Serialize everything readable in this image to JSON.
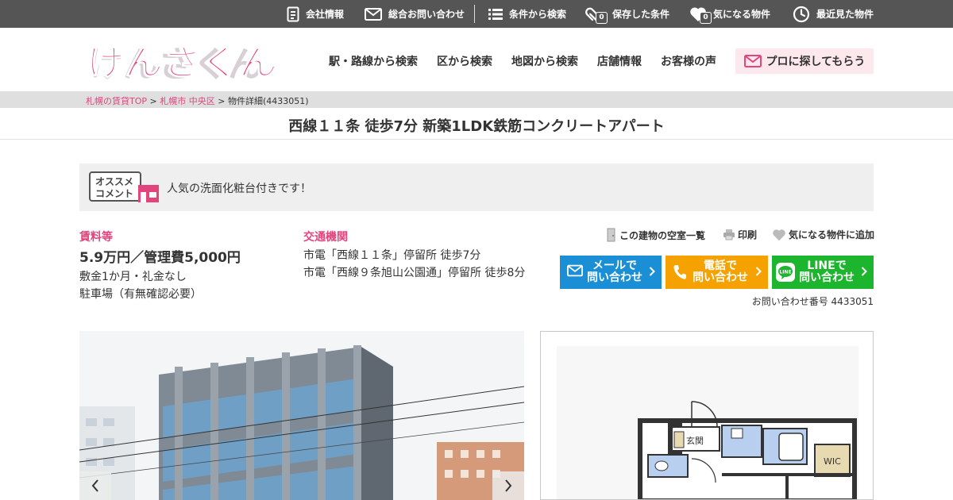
{
  "topbar": {
    "company": "会社情報",
    "contact": "総合お問い合わせ",
    "search_by_condition": "条件から検索",
    "saved_conditions": "保存した条件",
    "saved_count": "0",
    "favorites": "気になる物件",
    "favorites_count": "0",
    "recently_viewed": "最近見た物件"
  },
  "header": {
    "logo_text": "けんさくん",
    "nav": [
      "駅・路線から検索",
      "区から検索",
      "地図から検索",
      "店舗情報",
      "お客様の声"
    ],
    "pro_button": "プロに探してもらう"
  },
  "breadcrumb": {
    "home": "札幌の賃貸TOP",
    "sep": " > ",
    "area": "札幌市 中央区",
    "current": "物件詳細(4433051)"
  },
  "page_title": "西線１１条 徒歩7分 新築1LDK鉄筋コンクリートアパート",
  "recommend": {
    "badge_line1": "オススメ",
    "badge_line2": "コメント",
    "text": "人気の洗面化粧台付きです！"
  },
  "rent": {
    "label": "賃料等",
    "price": "5.9万円／管理費5,000円",
    "deposit": "敷金1か月・礼金なし",
    "parking": "駐車場（有無確認必要）"
  },
  "transport": {
    "label": "交通機関",
    "lines": [
      "市電「西線１１条」停留所 徒歩7分",
      "市電「西線９条旭山公園通」停留所 徒歩8分"
    ]
  },
  "tools": {
    "vacancy_list": "この建物の空室一覧",
    "print": "印刷",
    "add_favorite": "気になる物件に追加"
  },
  "cta": {
    "mail_line1": "メールで",
    "mail_line2": "問い合わせ",
    "phone_line1": "電話で",
    "phone_line2": "問い合わせ",
    "line_line1": "LINEで",
    "line_line2": "問い合わせ",
    "line_icon_text": "LINE",
    "inquiry_number": "お問い合わせ番号 4433051"
  },
  "floorplan": {
    "entrance": "玄関",
    "wic": "WIC"
  },
  "colors": {
    "accent_pink": "#e4447c",
    "topbar_bg": "#555555",
    "mail_blue": "#1a8fd6",
    "phone_orange": "#f5a100",
    "line_green": "#1db52e"
  }
}
